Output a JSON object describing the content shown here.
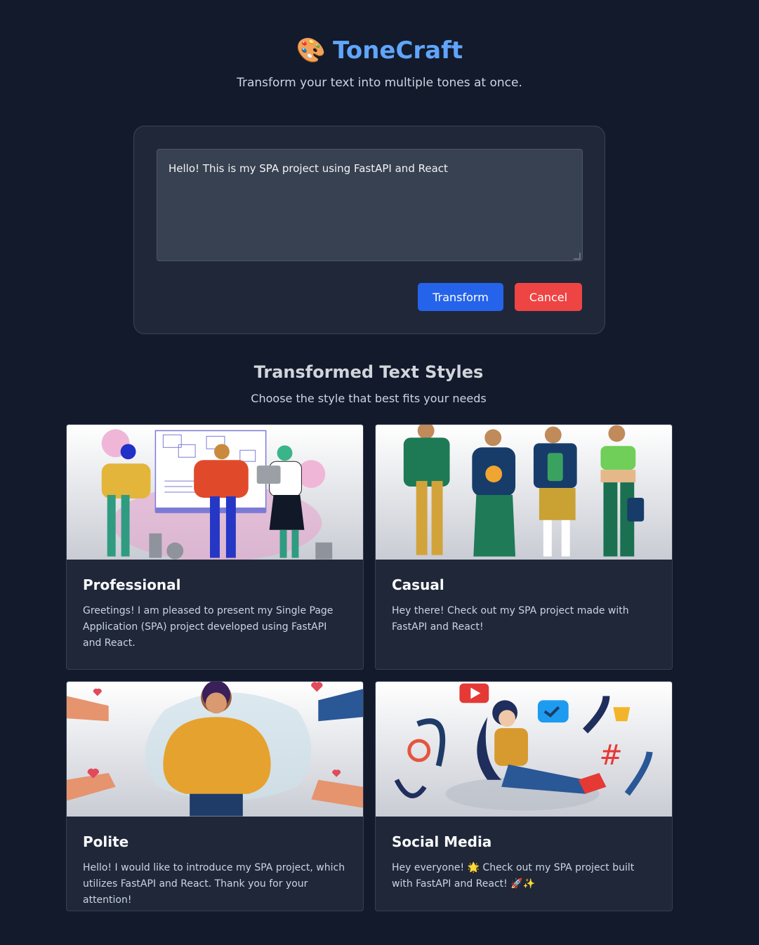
{
  "app": {
    "icon": "palette-icon",
    "title": "ToneCraft",
    "subtitle": "Transform your text into multiple tones at once."
  },
  "input": {
    "value": "Hello! This is my SPA project using FastAPI and React",
    "transform_label": "Transform",
    "cancel_label": "Cancel"
  },
  "results": {
    "title": "Transformed Text Styles",
    "subtitle": "Choose the style that best fits your needs",
    "cards": [
      {
        "title": "Professional",
        "text": "Greetings! I am pleased to present my Single Page Application (SPA) project developed using FastAPI and React."
      },
      {
        "title": "Casual",
        "text": "Hey there! Check out my SPA project made with FastAPI and React!"
      },
      {
        "title": "Polite",
        "text": "Hello! I would like to introduce my SPA project, which utilizes FastAPI and React. Thank you for your attention!"
      },
      {
        "title": "Social Media",
        "text": "Hey everyone! 🌟 Check out my SPA project built with FastAPI and React! 🚀✨"
      }
    ]
  },
  "colors": {
    "background": "#131a2c",
    "accent": "#60a5fa",
    "transform_button": "#2563eb",
    "cancel_button": "#ef4444"
  }
}
